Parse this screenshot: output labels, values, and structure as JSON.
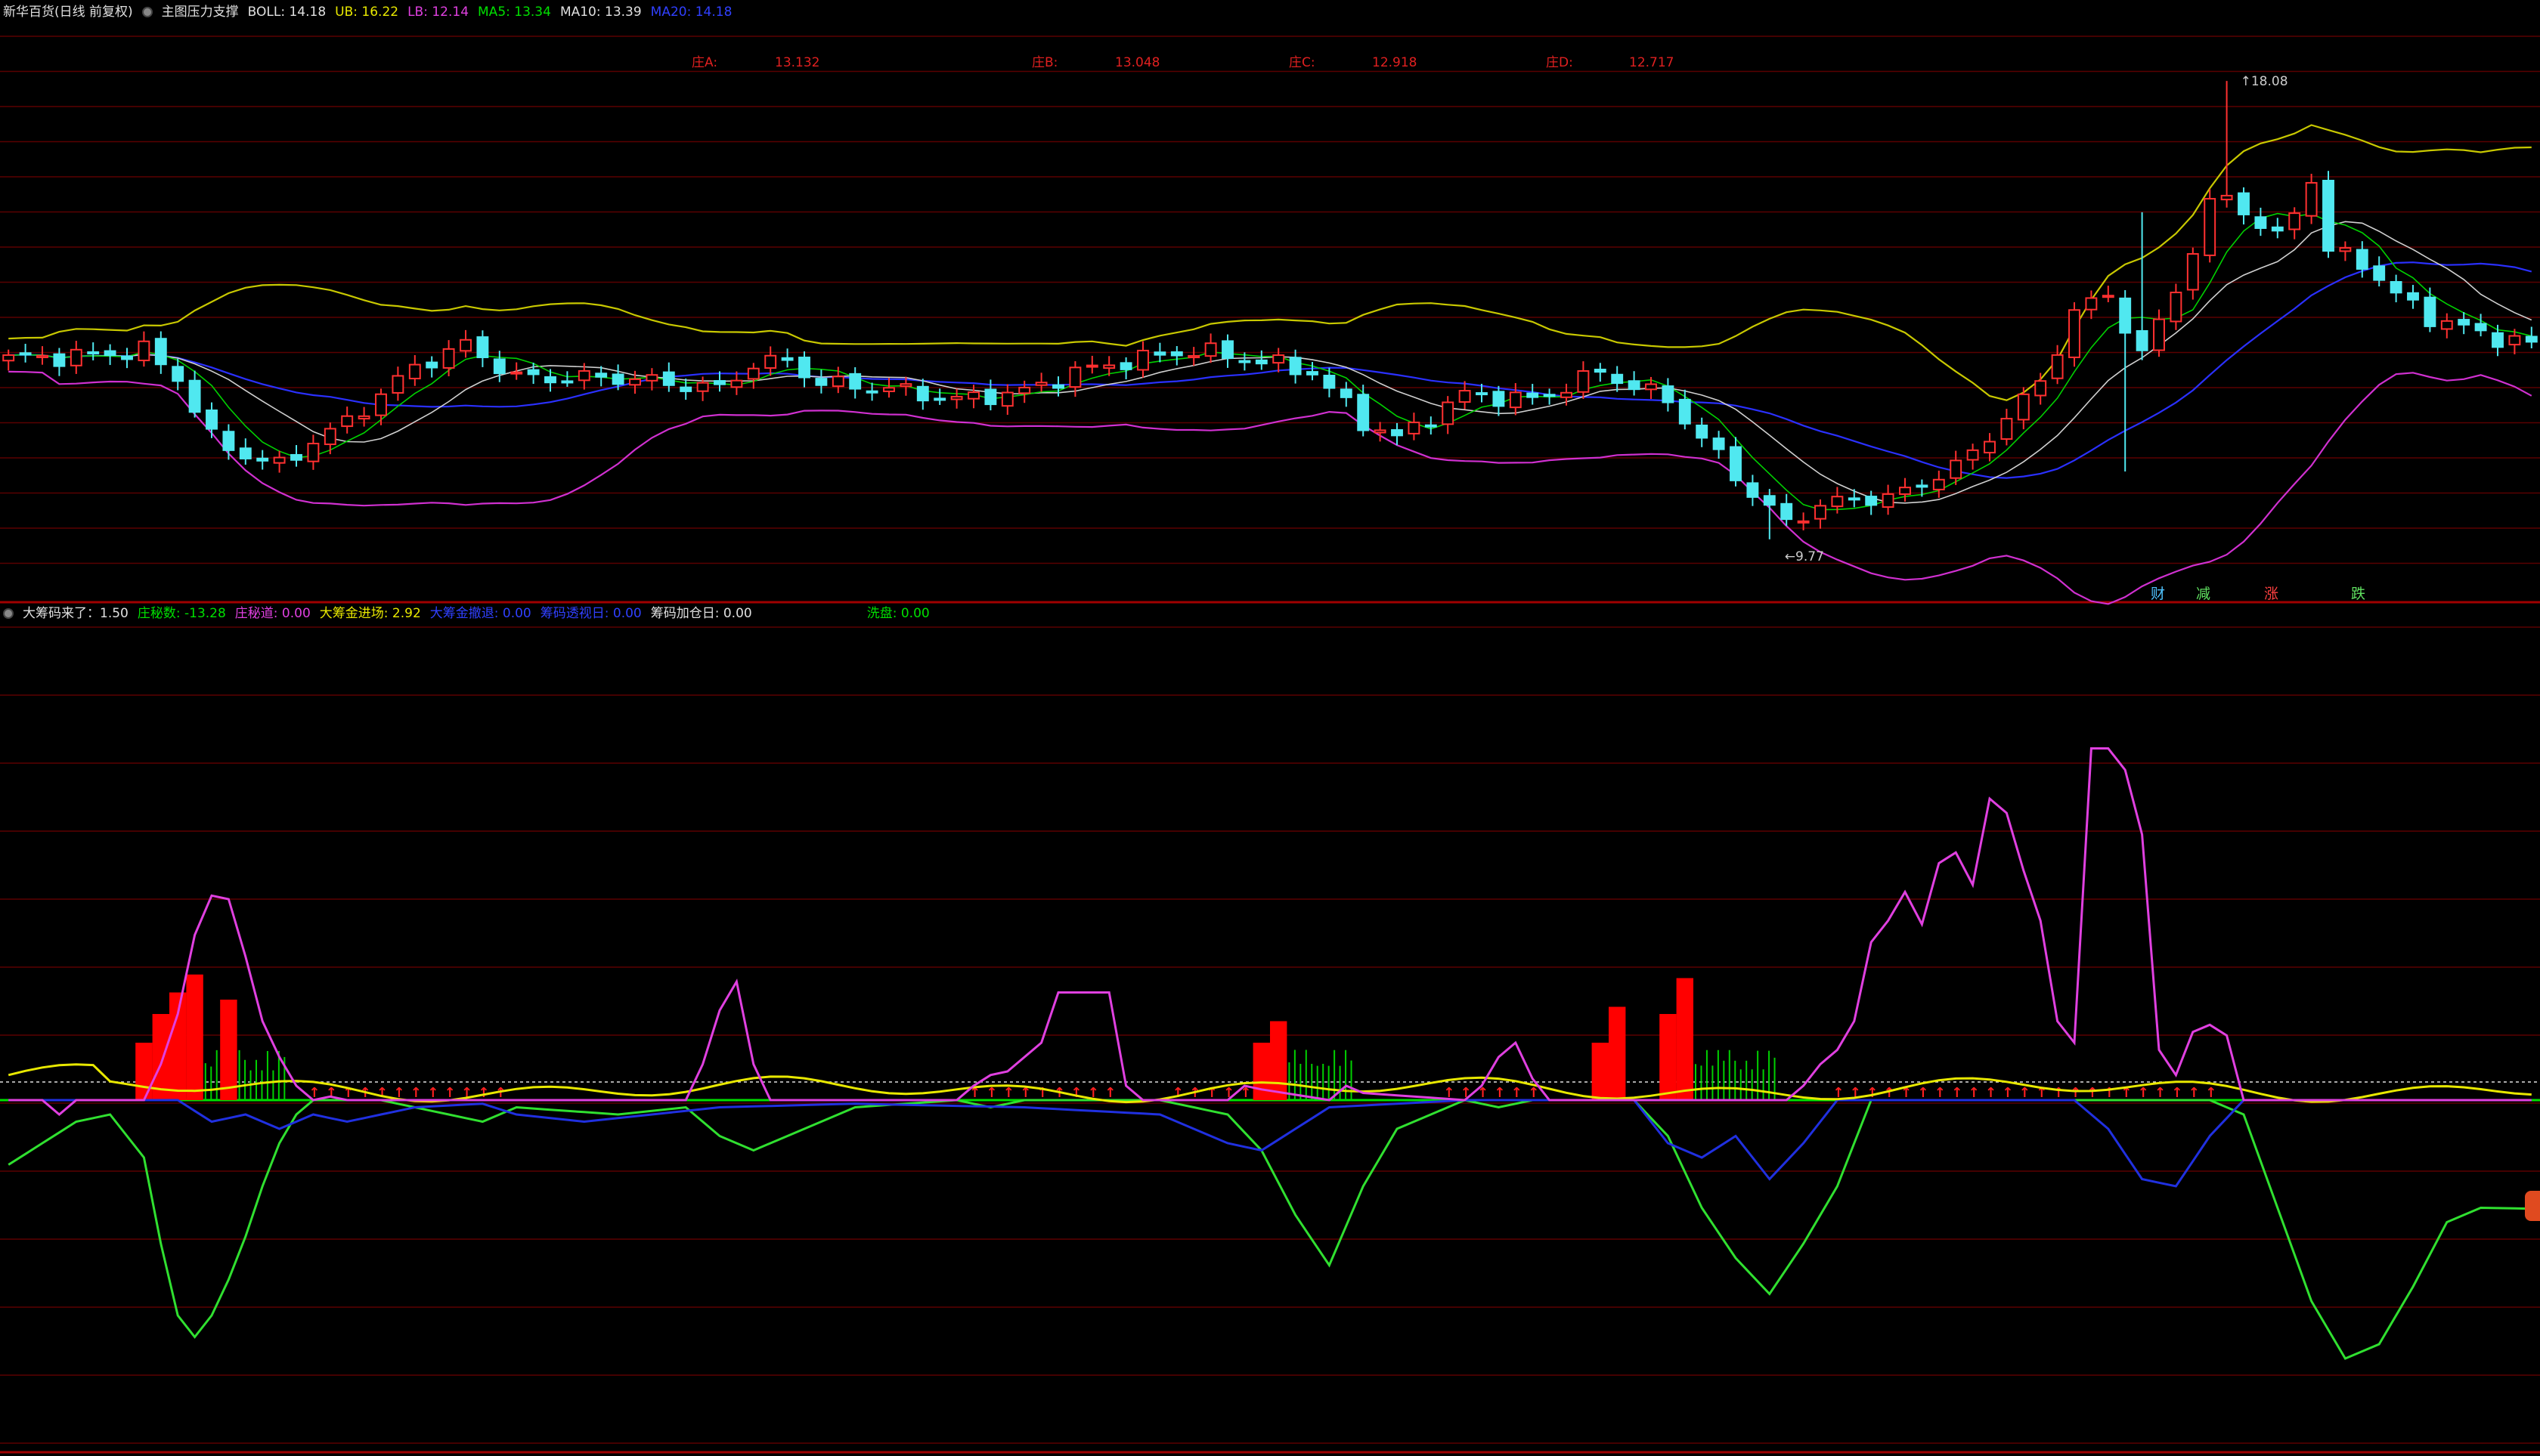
{
  "header_top": {
    "stock": "新华百货(日线 前复权)",
    "indicator": "主图压力支撑",
    "items": [
      {
        "label": "BOLL: 14.18",
        "color": "#e0e0e0"
      },
      {
        "label": "UB: 16.22",
        "color": "#e8e800"
      },
      {
        "label": "LB: 12.14",
        "color": "#e040e0"
      },
      {
        "label": "MA5: 13.34",
        "color": "#00e000"
      },
      {
        "label": "MA10: 13.39",
        "color": "#e0e0e0"
      },
      {
        "label": "MA20: 14.18",
        "color": "#3040ff"
      }
    ]
  },
  "annotations_top": [
    {
      "label": "庄A:",
      "value": "13.132"
    },
    {
      "label": "庄B:",
      "value": "13.048"
    },
    {
      "label": "庄C:",
      "value": "12.918"
    },
    {
      "label": "庄D:",
      "value": "12.717"
    }
  ],
  "price_marks": {
    "high": "18.08",
    "low": "9.77"
  },
  "divider_tags": [
    {
      "text": "财",
      "color": "#4fc3ff"
    },
    {
      "text": "减",
      "color": "#60e060"
    },
    {
      "text": "涨",
      "color": "#ff4040"
    },
    {
      "text": "跌",
      "color": "#60e060"
    }
  ],
  "header_bottom": {
    "items": [
      {
        "label": "大筹码来了：1.50",
        "color": "#e0e0e0",
        "hl": "#e8e800"
      },
      {
        "label": "庄秘数: -13.28",
        "color": "#00e000"
      },
      {
        "label": "庄秘道: 0.00",
        "color": "#e040e0"
      },
      {
        "label": "大筹金进场: 2.92",
        "color": "#e8e800"
      },
      {
        "label": "大筹金撤退: 0.00",
        "color": "#3040ff"
      },
      {
        "label": "筹码透视日: 0.00",
        "color": "#3040ff"
      },
      {
        "label": "筹码加仓日: 0.00",
        "color": "#e0e0e0"
      },
      {
        "label": "洗盘: 0.00",
        "color": "#00e000"
      }
    ]
  },
  "colors": {
    "up": "#ff3030",
    "down": "#50e8f0",
    "grid": "#5a0000",
    "divider": "#a00000"
  },
  "chart_data": [
    {
      "type": "candlestick",
      "series_names": [
        "BOLL",
        "UB",
        "LB",
        "MA5",
        "MA10",
        "MA20"
      ],
      "count": 150,
      "ylim": [
        9.0,
        19.0
      ],
      "high_mark": 18.08,
      "low_mark": 9.77
    },
    {
      "type": "line",
      "series_names": [
        "大筹码来了",
        "庄秘数",
        "庄秘道",
        "大筹金进场",
        "大筹金撤退"
      ],
      "count": 150
    }
  ]
}
